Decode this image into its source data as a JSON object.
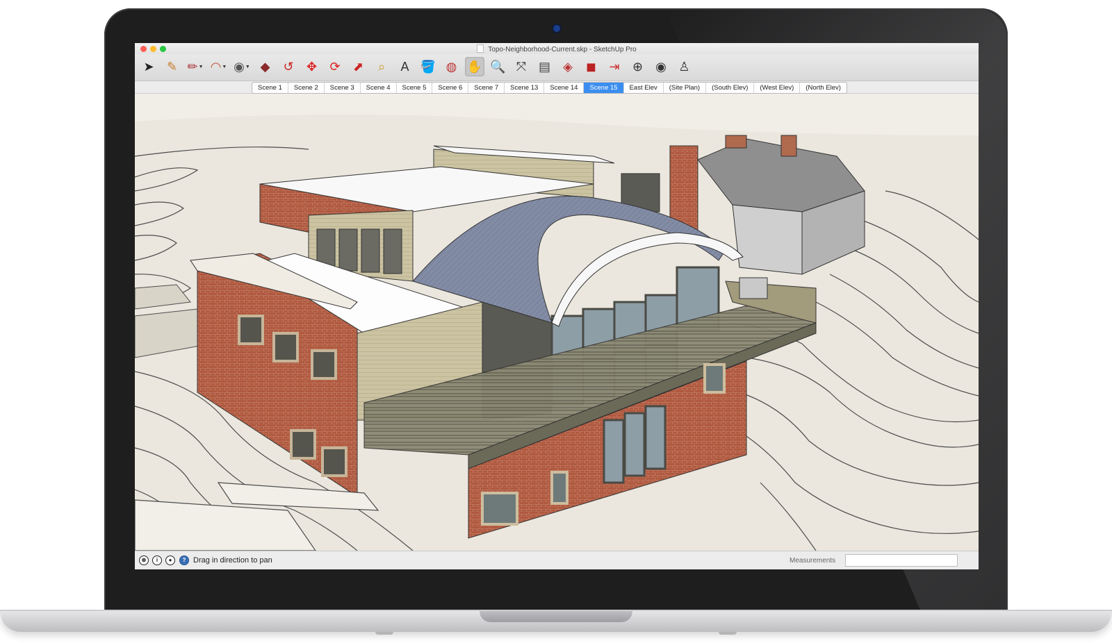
{
  "window": {
    "title": "Topo-Neighborhood-Current.skp - SketchUp Pro"
  },
  "toolbar": {
    "tools": [
      {
        "name": "select-icon",
        "glyph": "➤"
      },
      {
        "name": "eraser-icon",
        "glyph": "✎"
      },
      {
        "name": "pencil-icon",
        "glyph": "✏"
      },
      {
        "name": "arc-icon",
        "glyph": "◠"
      },
      {
        "name": "circle-icon",
        "glyph": "◉"
      },
      {
        "name": "push-pull-icon",
        "glyph": "◆"
      },
      {
        "name": "follow-me-icon",
        "glyph": "↺"
      },
      {
        "name": "move-icon",
        "glyph": "✥"
      },
      {
        "name": "rotate-icon",
        "glyph": "⟳"
      },
      {
        "name": "scale-icon",
        "glyph": "⬈"
      },
      {
        "name": "tape-measure-icon",
        "glyph": "⌕"
      },
      {
        "name": "text-icon",
        "glyph": "A"
      },
      {
        "name": "paint-bucket-icon",
        "glyph": "🪣"
      },
      {
        "name": "orbit-icon",
        "glyph": "◍"
      },
      {
        "name": "pan-icon",
        "glyph": "✋"
      },
      {
        "name": "zoom-icon",
        "glyph": "🔍"
      },
      {
        "name": "zoom-extents-icon",
        "glyph": "⤧"
      },
      {
        "name": "previous-view-icon",
        "glyph": "▤"
      },
      {
        "name": "warehouse-icon",
        "glyph": "◈"
      },
      {
        "name": "components-icon",
        "glyph": "◼"
      },
      {
        "name": "send-to-layout-icon",
        "glyph": "⇥"
      },
      {
        "name": "position-camera-icon",
        "glyph": "⊕"
      },
      {
        "name": "look-around-icon",
        "glyph": "◉"
      },
      {
        "name": "walk-icon",
        "glyph": "♙"
      }
    ]
  },
  "scenes": {
    "tabs": [
      "Scene 1",
      "Scene 2",
      "Scene 3",
      "Scene 4",
      "Scene 5",
      "Scene 6",
      "Scene 7",
      "Scene 13",
      "Scene 14",
      "Scene 15",
      "East Elev",
      "(Site Plan)",
      "(South Elev)",
      "(West Elev)",
      "(North Elev)"
    ],
    "selected": "Scene 15"
  },
  "statusbar": {
    "icons": [
      "geo-location-icon",
      "info-icon",
      "user-icon",
      "help-icon"
    ],
    "message": "Drag in direction to pan",
    "measurements_label": "Measurements",
    "measurements_value": ""
  },
  "colors": {
    "accent": "#3b8ef0",
    "brick": "#b0593f",
    "terrain": "#ebe7de",
    "roof": "#7f8aa3"
  }
}
